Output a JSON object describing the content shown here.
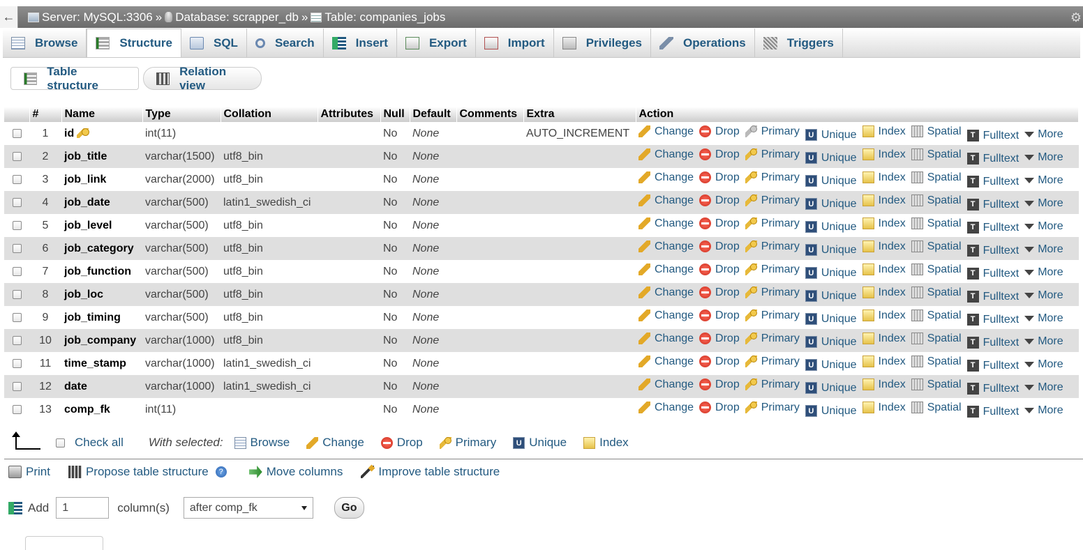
{
  "breadcrumb": {
    "back": "←",
    "server": "Server: MySQL:3306",
    "database": "Database: scrapper_db",
    "table": "Table: companies_jobs",
    "sep": "»"
  },
  "tabs": [
    {
      "label": "Browse",
      "icon": "browse-icon"
    },
    {
      "label": "Structure",
      "icon": "structure-icon",
      "active": true
    },
    {
      "label": "SQL",
      "icon": "sql-icon"
    },
    {
      "label": "Search",
      "icon": "search-icon"
    },
    {
      "label": "Insert",
      "icon": "insert-icon"
    },
    {
      "label": "Export",
      "icon": "export-icon"
    },
    {
      "label": "Import",
      "icon": "import-icon"
    },
    {
      "label": "Privileges",
      "icon": "privileges-icon"
    },
    {
      "label": "Operations",
      "icon": "operations-icon"
    },
    {
      "label": "Triggers",
      "icon": "triggers-icon"
    }
  ],
  "subtabs": {
    "table_structure": "Table structure",
    "relation_view": "Relation view"
  },
  "columns_header": [
    "#",
    "Name",
    "Type",
    "Collation",
    "Attributes",
    "Null",
    "Default",
    "Comments",
    "Extra",
    "Action"
  ],
  "rows": [
    {
      "num": "1",
      "name": "id",
      "type": "int(11)",
      "collation": "",
      "null": "No",
      "default": "None",
      "extra": "AUTO_INCREMENT",
      "primary_key": true
    },
    {
      "num": "2",
      "name": "job_title",
      "type": "varchar(1500)",
      "collation": "utf8_bin",
      "null": "No",
      "default": "None",
      "extra": ""
    },
    {
      "num": "3",
      "name": "job_link",
      "type": "varchar(2000)",
      "collation": "utf8_bin",
      "null": "No",
      "default": "None",
      "extra": ""
    },
    {
      "num": "4",
      "name": "job_date",
      "type": "varchar(500)",
      "collation": "latin1_swedish_ci",
      "null": "No",
      "default": "None",
      "extra": ""
    },
    {
      "num": "5",
      "name": "job_level",
      "type": "varchar(500)",
      "collation": "utf8_bin",
      "null": "No",
      "default": "None",
      "extra": ""
    },
    {
      "num": "6",
      "name": "job_category",
      "type": "varchar(500)",
      "collation": "utf8_bin",
      "null": "No",
      "default": "None",
      "extra": ""
    },
    {
      "num": "7",
      "name": "job_function",
      "type": "varchar(500)",
      "collation": "utf8_bin",
      "null": "No",
      "default": "None",
      "extra": ""
    },
    {
      "num": "8",
      "name": "job_loc",
      "type": "varchar(500)",
      "collation": "utf8_bin",
      "null": "No",
      "default": "None",
      "extra": ""
    },
    {
      "num": "9",
      "name": "job_timing",
      "type": "varchar(500)",
      "collation": "utf8_bin",
      "null": "No",
      "default": "None",
      "extra": ""
    },
    {
      "num": "10",
      "name": "job_company",
      "type": "varchar(1000)",
      "collation": "utf8_bin",
      "null": "No",
      "default": "None",
      "extra": ""
    },
    {
      "num": "11",
      "name": "time_stamp",
      "type": "varchar(1000)",
      "collation": "latin1_swedish_ci",
      "null": "No",
      "default": "None",
      "extra": ""
    },
    {
      "num": "12",
      "name": "date",
      "type": "varchar(1000)",
      "collation": "latin1_swedish_ci",
      "null": "No",
      "default": "None",
      "extra": ""
    },
    {
      "num": "13",
      "name": "comp_fk",
      "type": "int(11)",
      "collation": "",
      "null": "No",
      "default": "None",
      "extra": ""
    }
  ],
  "actions": {
    "change": "Change",
    "drop": "Drop",
    "primary": "Primary",
    "unique": "Unique",
    "index": "Index",
    "spatial": "Spatial",
    "fulltext": "Fulltext",
    "more": "More"
  },
  "with_selected": {
    "check_all": "Check all",
    "label": "With selected:",
    "browse": "Browse",
    "change": "Change",
    "drop": "Drop",
    "primary": "Primary",
    "unique": "Unique",
    "index": "Index"
  },
  "tools": {
    "print": "Print",
    "propose": "Propose table structure",
    "help": "?",
    "move": "Move columns",
    "improve": "Improve table structure"
  },
  "add_columns": {
    "label": "Add",
    "count": "1",
    "unit": "column(s)",
    "position": "after comp_fk",
    "go": "Go"
  },
  "colors": {
    "link": "#235a81",
    "row_alt": "#dfdfdf",
    "breadcrumb_bg": "#7a7a7a"
  }
}
